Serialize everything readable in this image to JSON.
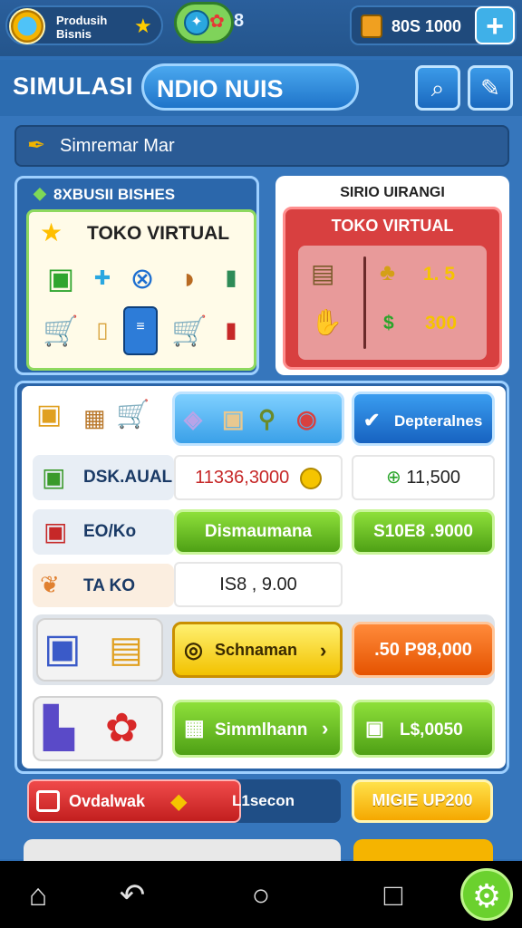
{
  "topbar": {
    "profile_line1": "Produsih",
    "profile_line2": "Bisnis",
    "gem_digit": "8",
    "coins": "80S 1000",
    "plus": "+"
  },
  "header": {
    "title_left": "SIMULASI",
    "title_pill": "NDIO NUIS"
  },
  "search": {
    "text": "Simremar Mar"
  },
  "left_card": {
    "title": "8XBUSII BISHES",
    "inner_title": "TOKO VIRTUAL"
  },
  "right_card": {
    "title": "SIRIO UIRANGI",
    "inner_title": "TOKO VIRTUAL",
    "value_1": "1. 5",
    "value_2_symbol": "$",
    "value_2": "300"
  },
  "rows": {
    "top_button": "Depteralnes",
    "row1": {
      "label": "DSK.AUAL",
      "value": "11336,3000",
      "right_value": "11,500"
    },
    "row2": {
      "label": "EO/Ko",
      "button": "Dismaumana",
      "right_button": "S10E8 .9000"
    },
    "row3": {
      "label": "TA KO",
      "value": "IS8 , 9.00"
    },
    "row4": {
      "button": "Schnaman",
      "right_button": ".50 P98,000"
    },
    "row5": {
      "button": "Simmlhann",
      "right_button": "L$,0050"
    }
  },
  "bottom": {
    "left_label": "Ovdalwak",
    "left_text": "L1secon",
    "right_button": "MIGIE UP200"
  },
  "colors": {
    "accent_blue": "#2f6fb5",
    "green": "#6bd12e",
    "orange": "#e55300",
    "yellow": "#f2c200",
    "red": "#d84040"
  }
}
